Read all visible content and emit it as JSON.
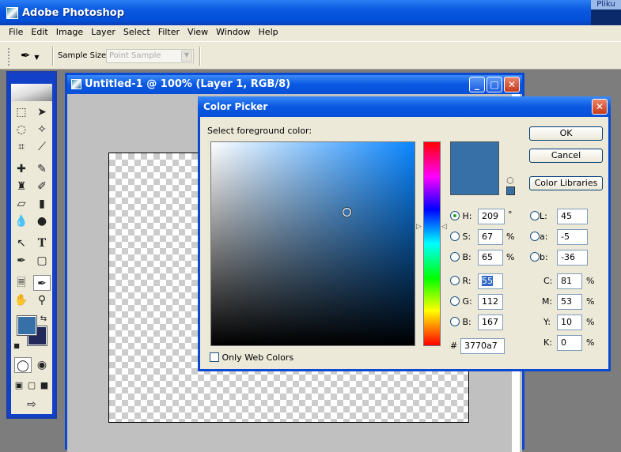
{
  "app": {
    "title": "Adobe Photoshop",
    "taskbar_label": "Pliku"
  },
  "menu": [
    "File",
    "Edit",
    "Image",
    "Layer",
    "Select",
    "Filter",
    "View",
    "Window",
    "Help"
  ],
  "options": {
    "sample_size_label": "Sample Size:",
    "sample_size_value": "Point Sample"
  },
  "document": {
    "title": "Untitled-1 @ 100% (Layer 1, RGB/8)"
  },
  "colors": {
    "foreground": "#3770a7",
    "background": "#22285a"
  },
  "picker": {
    "title": "Color Picker",
    "prompt": "Select foreground color:",
    "ok": "OK",
    "cancel": "Cancel",
    "libraries": "Color Libraries",
    "H": {
      "label": "H:",
      "value": "209",
      "unit": "°"
    },
    "S": {
      "label": "S:",
      "value": "67",
      "unit": "%"
    },
    "Bv": {
      "label": "B:",
      "value": "65",
      "unit": "%"
    },
    "R": {
      "label": "R:",
      "value": "55"
    },
    "G": {
      "label": "G:",
      "value": "112"
    },
    "B": {
      "label": "B:",
      "value": "167"
    },
    "L": {
      "label": "L:",
      "value": "45"
    },
    "a": {
      "label": "a:",
      "value": "-5"
    },
    "b": {
      "label": "b:",
      "value": "-36"
    },
    "C": {
      "label": "C:",
      "value": "81",
      "unit": "%"
    },
    "M": {
      "label": "M:",
      "value": "53",
      "unit": "%"
    },
    "Y": {
      "label": "Y:",
      "value": "10",
      "unit": "%"
    },
    "K": {
      "label": "K:",
      "value": "0",
      "unit": "%"
    },
    "hex_label": "#",
    "hex": "3770a7",
    "web_colors": "Only Web Colors"
  }
}
